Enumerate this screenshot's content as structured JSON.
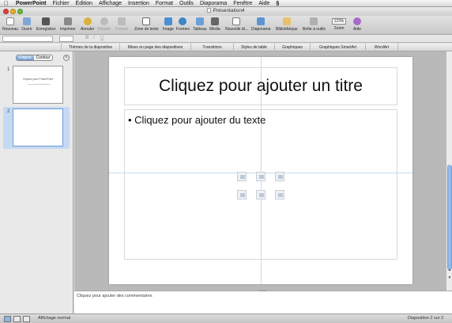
{
  "menubar": {
    "apple_icon": "apple-logo",
    "items": [
      "PowerPoint",
      "Fichier",
      "Édition",
      "Affichage",
      "Insertion",
      "Format",
      "Outils",
      "Diaporama",
      "Fenêtre",
      "Aide"
    ]
  },
  "window": {
    "title": "Présentation4"
  },
  "toolbar": {
    "nouveau": "Nouveau",
    "ouvrir": "Ouvrir",
    "enregistrer": "Enregistrer",
    "imprimer": "Imprimer",
    "annuler": "Annuler",
    "retablir": "Rétablir",
    "format": "Format",
    "zone_texte": "Zone de texte",
    "image": "Image",
    "formes": "Formes",
    "tableau": "Tableau",
    "media": "Média",
    "nouvelle_diapo": "Nouvelle di...",
    "diaporama": "Diaporama",
    "bibliotheque": "Bibliothèque",
    "boite_outils": "Boîte à outils",
    "zoom": "Zoom",
    "zoom_value": "123%",
    "aide": "Aide"
  },
  "ribbon": {
    "tabs": [
      "Thèmes de la diapositive",
      "Mises en page des diapositives",
      "Transitions",
      "Styles de table",
      "Graphiques",
      "Graphiques SmartArt",
      "WordArt"
    ]
  },
  "leftpane": {
    "tab_diapos": "Diapos",
    "tab_contour": "Contour",
    "close_icon": "×",
    "thumb1_number": "1",
    "thumb2_number": "2",
    "thumb1_title": "Cliquez pour PowerPoint"
  },
  "slide": {
    "title_placeholder": "Cliquez pour ajouter un titre",
    "body_placeholder": "• Cliquez pour ajouter du texte"
  },
  "notes": {
    "placeholder": "Cliquez pour ajouter des commentaires",
    "handle": "• • •"
  },
  "statusbar": {
    "view_label": "Affichage normal",
    "slide_counter": "Diapositive 2 sur 2"
  },
  "colors": {
    "accent": "#6c9ad5",
    "selection": "#c6d9f3",
    "guides": "#c4dcef"
  }
}
